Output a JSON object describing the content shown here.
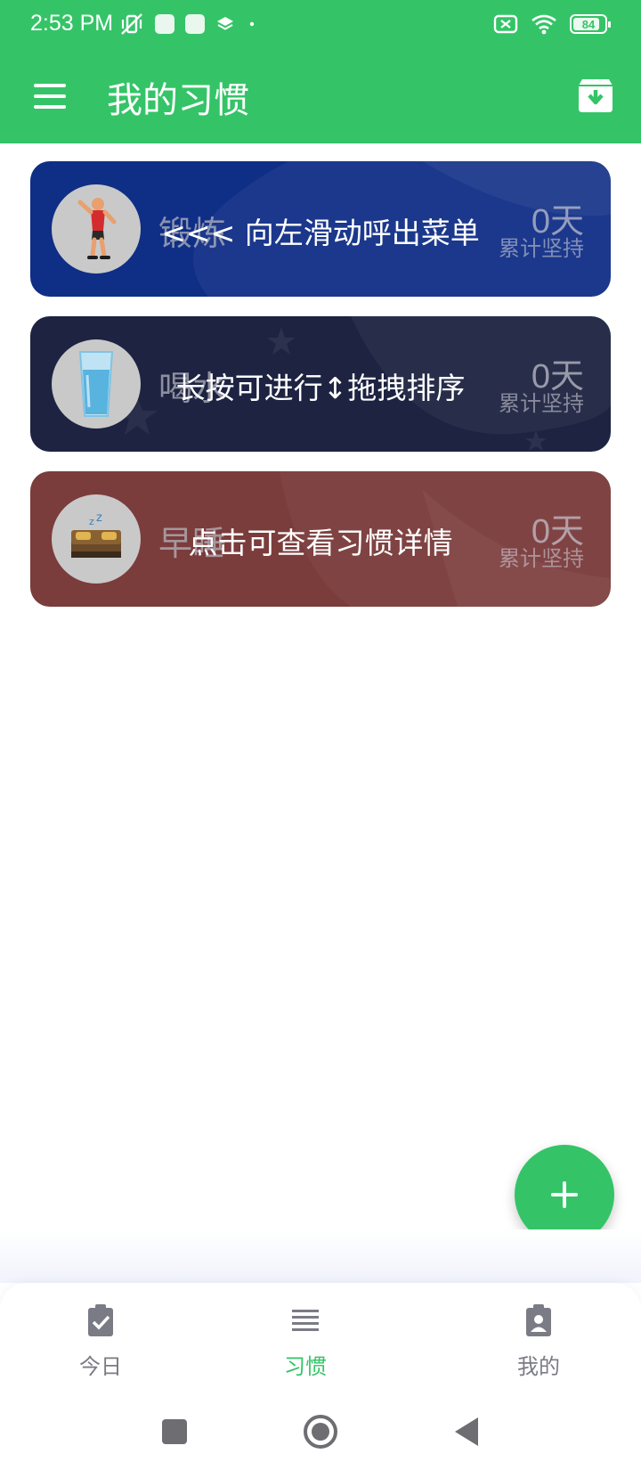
{
  "status_bar": {
    "time": "2:53 PM",
    "battery_level": "84",
    "battery_fraction": 0.84
  },
  "app_bar": {
    "title": "我的习惯",
    "menu_icon": "menu-icon",
    "archive_icon": "archive-download-icon"
  },
  "habits": [
    {
      "name": "锻炼",
      "days": "0天",
      "days_label": "累计坚持",
      "hint": "<<< 向左滑动呼出菜单",
      "bg_color": "#0f2e86",
      "icon": "exercise-person-icon"
    },
    {
      "name": "喝水",
      "days": "0天",
      "days_label": "累计坚持",
      "hint": "长按可进行↕拖拽排序",
      "bg_color": "#1d2341",
      "icon": "water-glass-icon"
    },
    {
      "name": "早睡",
      "days": "0天",
      "days_label": "累计坚持",
      "hint": "点击可查看习惯详情",
      "bg_color": "#7b3c3c",
      "icon": "bed-sleep-icon"
    }
  ],
  "fab": {
    "icon": "plus-icon"
  },
  "bottom_nav": [
    {
      "label": "今日",
      "icon": "clipboard-check-icon",
      "active": false
    },
    {
      "label": "习惯",
      "icon": "list-lines-icon",
      "active": true
    },
    {
      "label": "我的",
      "icon": "clipboard-person-icon",
      "active": false
    }
  ],
  "colors": {
    "primary": "#34c467",
    "nav_inactive": "#7b7b86"
  },
  "system_nav": [
    "recent-apps-square-icon",
    "home-circle-icon",
    "back-triangle-icon"
  ]
}
